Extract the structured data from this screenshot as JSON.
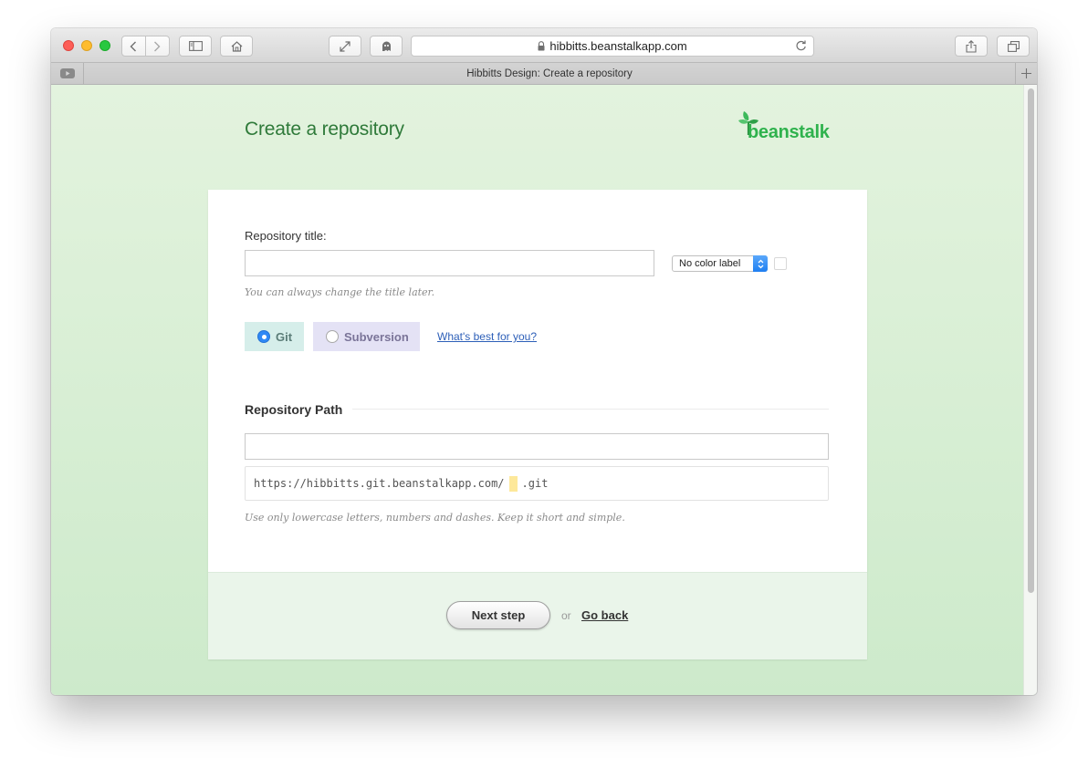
{
  "browser": {
    "url": "hibbitts.beanstalkapp.com",
    "tab_title": "Hibbitts Design: Create a repository"
  },
  "page": {
    "title": "Create a repository",
    "logo_text": "beanstalk"
  },
  "form": {
    "title_label": "Repository title:",
    "title_value": "",
    "color_label_select": "No color label",
    "title_hint": "You can always change the title later.",
    "vcs_options": [
      {
        "label": "Git",
        "selected": true
      },
      {
        "label": "Subversion",
        "selected": false
      }
    ],
    "vcs_help_link": "What's best for you?",
    "path_section_title": "Repository Path",
    "path_value": "",
    "path_prefix": "https://hibbitts.git.beanstalkapp.com/",
    "path_suffix": ".git",
    "path_hint": "Use only lowercase letters, numbers and dashes. Keep it short and simple."
  },
  "footer": {
    "next_button": "Next step",
    "or_text": "or",
    "back_link": "Go back"
  },
  "colors": {
    "brand_green": "#2fb24d",
    "title_green": "#2f7a3a",
    "link_blue": "#2d5fb8",
    "radio_blue": "#2f88f5"
  }
}
